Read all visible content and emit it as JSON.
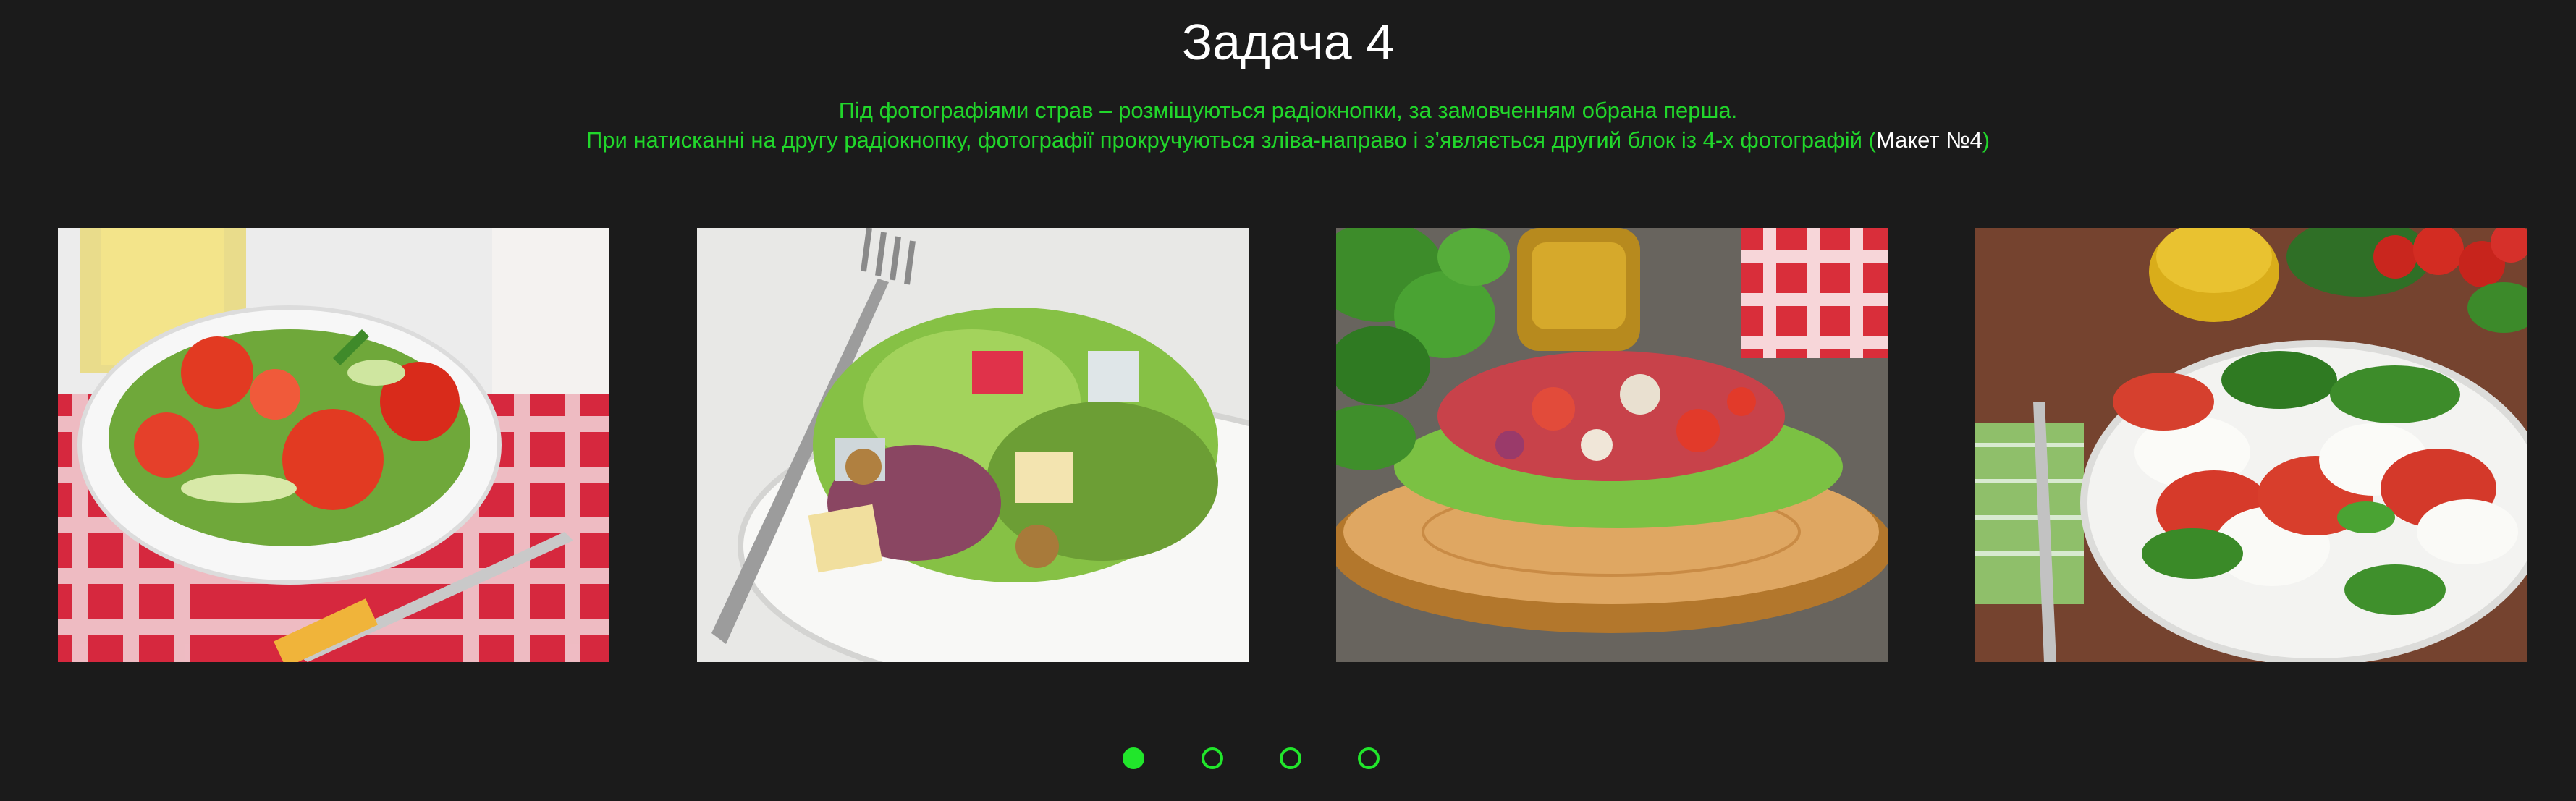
{
  "page": {
    "title": "Задача 4",
    "description_line1": "Під фотографіями страв – розміщуються радіокнопки, за замовченням обрана перша.",
    "description_line2_prefix": "При натисканні на другу радіокнопку, фотографії прокручуються зліва-направо і з’являється другий блок із 4-х фотографій (",
    "description_line2_ref": "Макет №4",
    "description_line2_suffix": ")"
  },
  "gallery": {
    "photos": [
      {
        "icon": "salad-photo-tomato-cucumber"
      },
      {
        "icon": "salad-photo-greens-apple-cheese"
      },
      {
        "icon": "salad-photo-bruschetta-on-wood"
      },
      {
        "icon": "salad-photo-caprese"
      }
    ]
  },
  "radios": {
    "count": 4,
    "selected_index": 0
  },
  "colors": {
    "background": "#1b1b1b",
    "accent_green": "#21e62b",
    "title_white": "#ffffff"
  }
}
